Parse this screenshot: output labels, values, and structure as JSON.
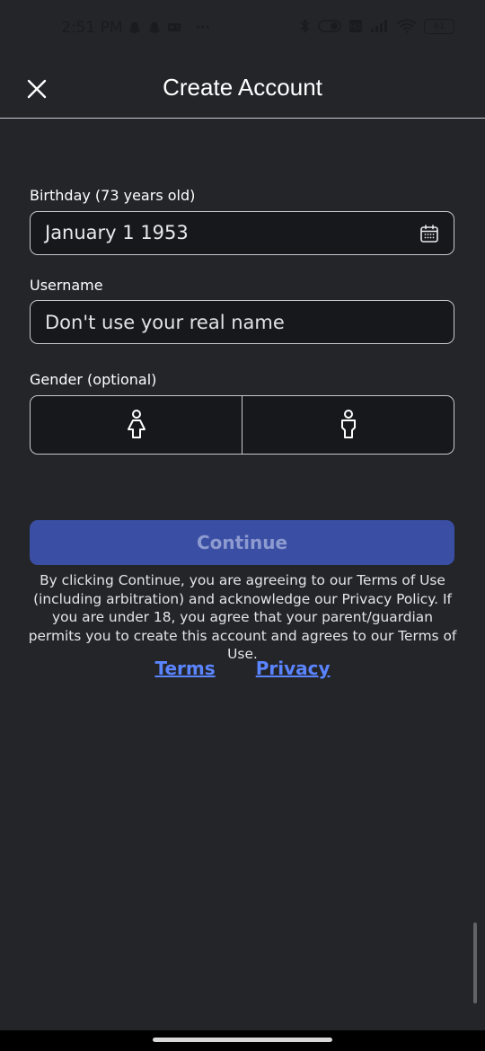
{
  "status_bar": {
    "time": "2:51 PM",
    "more_indicator": "···",
    "battery_level": "41",
    "icons": [
      "snapchat-icon",
      "snapchat-icon",
      "game-controller-icon",
      "bluetooth-icon",
      "toggle-icon",
      "data-icon",
      "signal-icon",
      "wifi-icon",
      "battery-icon"
    ]
  },
  "header": {
    "title": "Create Account",
    "close_icon": "close-icon"
  },
  "birthday": {
    "label": "Birthday (73 years old)",
    "value": "January 1 1953",
    "icon": "calendar-icon"
  },
  "username": {
    "label": "Username",
    "placeholder": "Don't use your real name",
    "value": ""
  },
  "gender": {
    "label": "Gender (optional)",
    "options": [
      {
        "icon": "female-icon"
      },
      {
        "icon": "male-icon"
      }
    ]
  },
  "continue_label": "Continue",
  "legal_text": "By clicking Continue, you are agreeing to our Terms of Use (including arbitration) and acknowledge our Privacy Policy. If you are under 18, you agree that your parent/guardian permits you to create this account and agrees to our Terms of Use.",
  "links": {
    "terms": "Terms",
    "privacy": "Privacy"
  },
  "colors": {
    "background": "#232529",
    "continue_button": "#3a4ea3",
    "link": "#5b84ff"
  }
}
